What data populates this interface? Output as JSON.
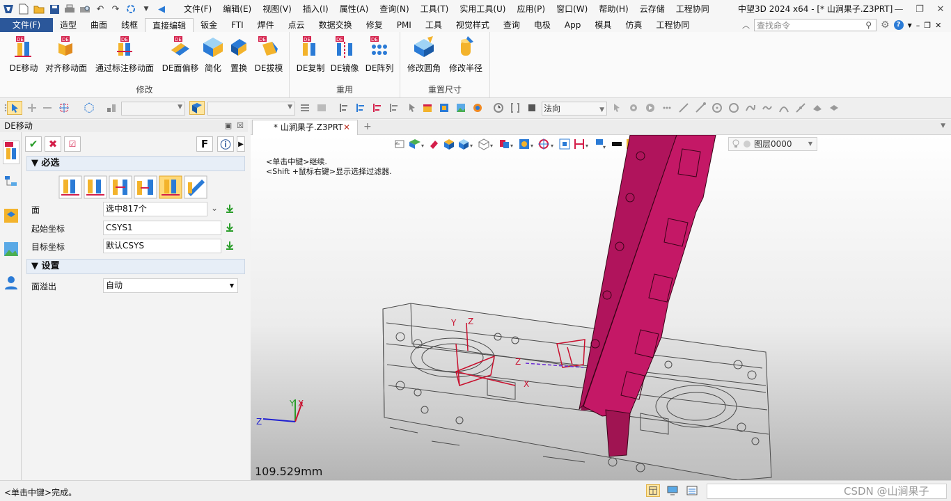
{
  "window": {
    "title": "中望3D 2024 x64 - [* 山涧果子.Z3PRT]"
  },
  "menu": [
    "文件(F)",
    "编辑(E)",
    "视图(V)",
    "插入(I)",
    "属性(A)",
    "查询(N)",
    "工具(T)",
    "实用工具(U)",
    "应用(P)",
    "窗口(W)",
    "帮助(H)",
    "云存储",
    "工程协同"
  ],
  "ribbon_tabs": [
    "文件(F)",
    "造型",
    "曲面",
    "线框",
    "直接编辑",
    "钣金",
    "FTI",
    "焊件",
    "点云",
    "数据交换",
    "修复",
    "PMI",
    "工具",
    "视觉样式",
    "查询",
    "电极",
    "App",
    "模具",
    "仿真",
    "工程协同"
  ],
  "active_tab": "直接编辑",
  "search": {
    "placeholder": "查找命令"
  },
  "ribbon": {
    "modify": {
      "label": "修改",
      "buttons": [
        "DE移动",
        "对齐移动面",
        "通过标注移动面",
        "DE面偏移",
        "简化",
        "置换",
        "DE拔模"
      ]
    },
    "reuse": {
      "label": "重用",
      "buttons": [
        "DE复制",
        "DE镜像",
        "DE阵列"
      ]
    },
    "resize": {
      "label": "重置尺寸",
      "buttons": [
        "修改圆角",
        "修改半径"
      ]
    }
  },
  "toolbar": {
    "filter_value": "法向"
  },
  "dock": {
    "title": "DE移动"
  },
  "panel": {
    "action_f": "F",
    "required": {
      "title": "必选",
      "rows": [
        {
          "label": "面",
          "value": "选中817个"
        },
        {
          "label": "起始坐标",
          "value": "CSYS1"
        },
        {
          "label": "目标坐标",
          "value": "默认CSYS"
        }
      ]
    },
    "settings": {
      "title": "设置",
      "rows": [
        {
          "label": "面溢出",
          "value": "自动"
        }
      ]
    }
  },
  "document_tab": {
    "name": "* 山涧果子.Z3PRT"
  },
  "viewport": {
    "hint_1": "<单击中键>继续.",
    "hint_2": "<Shift +鼠标右键>显示选择过滤器.",
    "dimension": "109.529mm",
    "layer": "图层0000",
    "triad_x": "X",
    "triad_y": "Y",
    "triad_z": "Z",
    "csys1_x": "X",
    "csys1_y": "Y",
    "csys1_z": "Z",
    "csys2_z": "Z"
  },
  "status": {
    "message": "<单击中键>完成。",
    "watermark": "CSDN @山涧果子"
  },
  "colors": {
    "accent": "#2b579a",
    "part_magenta": "#b0145c",
    "selection_red": "#c8102e"
  }
}
